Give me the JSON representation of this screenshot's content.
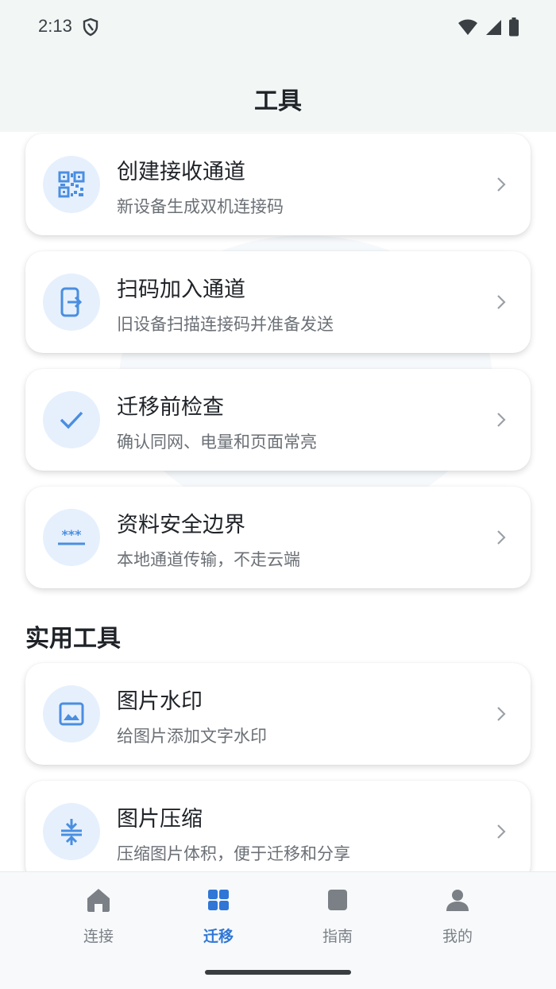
{
  "status_bar": {
    "time": "2:13"
  },
  "header": {
    "title": "工具"
  },
  "cards": [
    {
      "title": "创建接收通道",
      "subtitle": "新设备生成双机连接码",
      "icon": "qr-code-icon"
    },
    {
      "title": "扫码加入通道",
      "subtitle": "旧设备扫描连接码并准备发送",
      "icon": "phone-export-icon"
    },
    {
      "title": "迁移前检查",
      "subtitle": "确认同网、电量和页面常亮",
      "icon": "check-icon"
    },
    {
      "title": "资料安全边界",
      "subtitle": "本地通道传输，不走云端",
      "icon": "password-icon"
    }
  ],
  "section_title": "实用工具",
  "tools": [
    {
      "title": "图片水印",
      "subtitle": "给图片添加文字水印",
      "icon": "image-icon"
    },
    {
      "title": "图片压缩",
      "subtitle": "压缩图片体积，便于迁移和分享",
      "icon": "compress-icon"
    }
  ],
  "bottom_nav": [
    {
      "label": "连接",
      "icon": "home-icon",
      "active": false
    },
    {
      "label": "迁移",
      "icon": "grid-icon",
      "active": true
    },
    {
      "label": "指南",
      "icon": "book-icon",
      "active": false
    },
    {
      "label": "我的",
      "icon": "person-icon",
      "active": false
    }
  ],
  "colors": {
    "accent": "#2f76d6",
    "icon_bg": "#e6f0fd",
    "icon": "#4a8ee0",
    "header_bg": "#f2f7f6"
  }
}
